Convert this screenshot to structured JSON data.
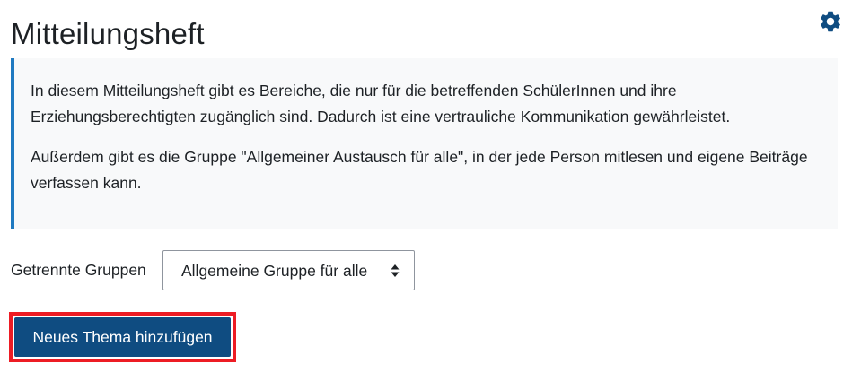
{
  "page": {
    "title": "Mitteilungsheft",
    "settings_icon": "gear-icon"
  },
  "intro": {
    "paragraph_1": "In diesem Mitteilungsheft gibt es Bereiche, die nur für die betreffenden SchülerInnen und ihre Erziehungsberechtigten zugänglich sind. Dadurch ist eine vertrauliche Kommunikation gewährleistet.",
    "paragraph_2": "Außerdem gibt es die Gruppe \"Allgemeiner Austausch für alle\", in der jede Person mitlesen und eigene Beiträge verfassen kann.",
    "accent_color": "#1f7ac1"
  },
  "group_filter": {
    "label": "Getrennte Gruppen",
    "selected": "Allgemeine Gruppe für alle",
    "caret_icon": "sort-caret-icon"
  },
  "actions": {
    "add_topic_label": "Neues Thema hinzufügen",
    "button_color": "#0f4c81",
    "highlight_color": "#ed1c24"
  }
}
